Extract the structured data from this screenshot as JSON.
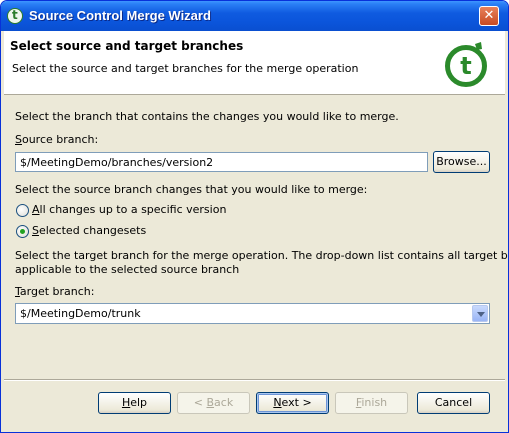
{
  "window": {
    "title": "Source Control Merge Wizard",
    "close_label": "✕"
  },
  "header": {
    "title": "Select source and target branches",
    "subtitle": "Select the source and target branches for the merge operation"
  },
  "source": {
    "instruction": "Select the branch that contains the changes you would like to merge.",
    "label_mnemonic": "S",
    "label_rest": "ource branch:",
    "value": "$/MeetingDemo/branches/version2",
    "browse_label": "Browse..."
  },
  "changes": {
    "instruction": "Select the source branch changes that you would like to merge:",
    "options": [
      {
        "mnemonic": "A",
        "rest": "ll changes up to a specific version",
        "checked": false
      },
      {
        "mnemonic": "S",
        "rest": "elected changesets",
        "checked": true
      }
    ]
  },
  "target": {
    "instruction_line1": "Select the target branch for the merge operation.  The drop-down list contains all target branches",
    "instruction_line2": "applicable to the selected source branch",
    "label_mnemonic": "T",
    "label_rest": "arget branch:",
    "value": "$/MeetingDemo/trunk"
  },
  "buttons": {
    "help": {
      "mnemonic": "H",
      "rest": "elp"
    },
    "back": {
      "prefix": "< ",
      "mnemonic": "B",
      "rest": "ack"
    },
    "next": {
      "mnemonic": "N",
      "rest": "ext >"
    },
    "finish": {
      "mnemonic": "F",
      "rest": "inish"
    },
    "cancel": "Cancel"
  },
  "colors": {
    "titlebar": "#0a4fd0",
    "logo": "#2b8a2b",
    "dialog_bg": "#ece9d8"
  }
}
